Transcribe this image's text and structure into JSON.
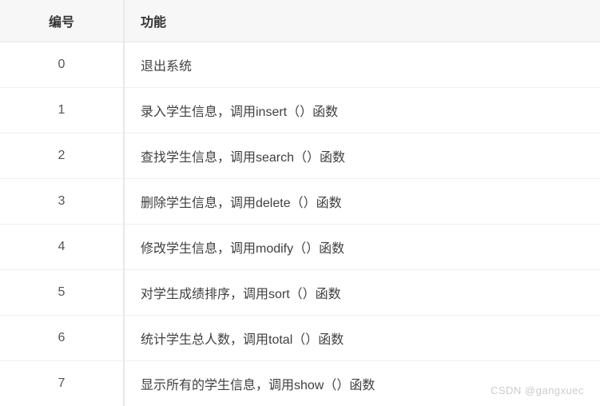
{
  "headers": {
    "id": "编号",
    "func": "功能"
  },
  "rows": [
    {
      "id": "0",
      "func": "退出系统"
    },
    {
      "id": "1",
      "func": "录入学生信息，调用insert（）函数"
    },
    {
      "id": "2",
      "func": "查找学生信息，调用search（）函数"
    },
    {
      "id": "3",
      "func": "删除学生信息，调用delete（）函数"
    },
    {
      "id": "4",
      "func": "修改学生信息，调用modify（）函数"
    },
    {
      "id": "5",
      "func": "对学生成绩排序，调用sort（）函数"
    },
    {
      "id": "6",
      "func": "统计学生总人数，调用total（）函数"
    },
    {
      "id": "7",
      "func": "显示所有的学生信息，调用show（）函数"
    }
  ],
  "watermark": "CSDN @gangxuec"
}
